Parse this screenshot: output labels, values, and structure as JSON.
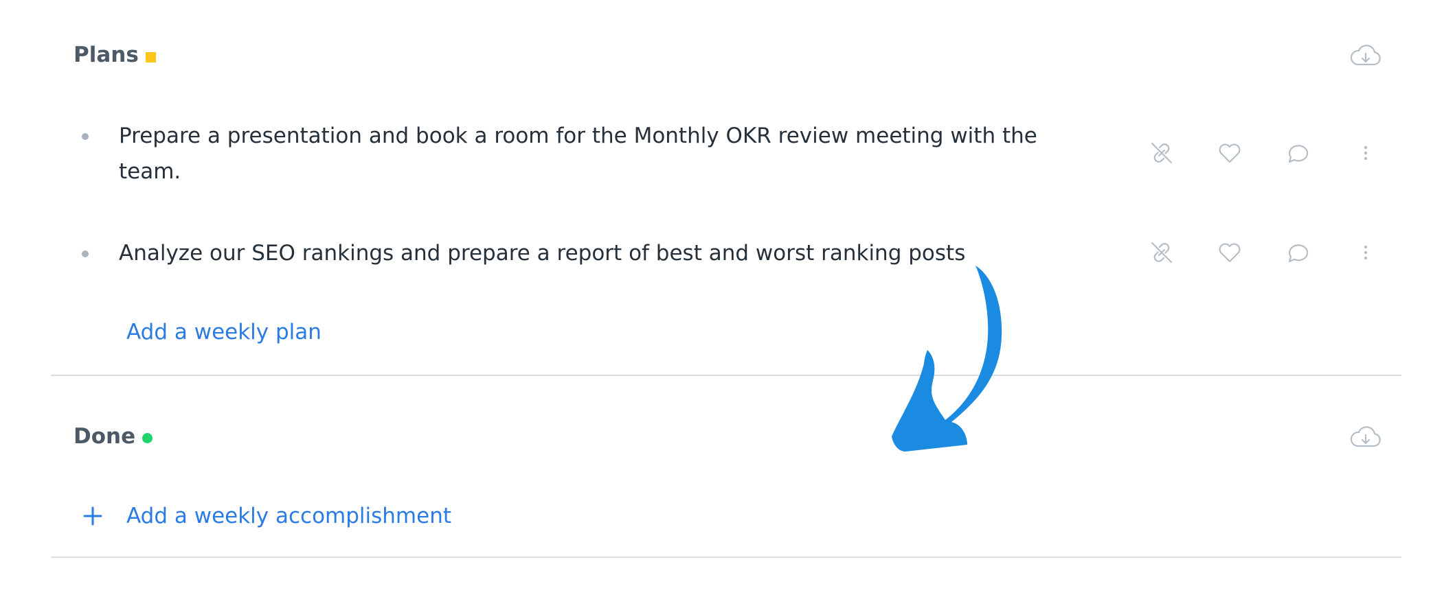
{
  "plans": {
    "title": "Plans",
    "marker_color": "#ffc61a",
    "download_icon": "cloud-download-icon",
    "items": [
      {
        "text": "Prepare a presentation and book a room for the Monthly OKR review meeting with the team.",
        "actions": [
          "unlink-icon",
          "heart-icon",
          "comment-icon",
          "more-vertical-icon"
        ]
      },
      {
        "text": "Analyze our SEO rankings and prepare a report of best and worst ranking posts",
        "actions": [
          "unlink-icon",
          "heart-icon",
          "comment-icon",
          "more-vertical-icon"
        ]
      }
    ],
    "add_label": "Add a weekly plan"
  },
  "done": {
    "title": "Done",
    "marker_color": "#1fd46b",
    "download_icon": "cloud-download-icon",
    "add_icon": "plus-icon",
    "add_label": "Add a weekly accomplishment"
  },
  "colors": {
    "link": "#2b7be4",
    "icon": "#b5bec7",
    "arrow": "#1a8be0",
    "divider": "#d8dee3"
  }
}
